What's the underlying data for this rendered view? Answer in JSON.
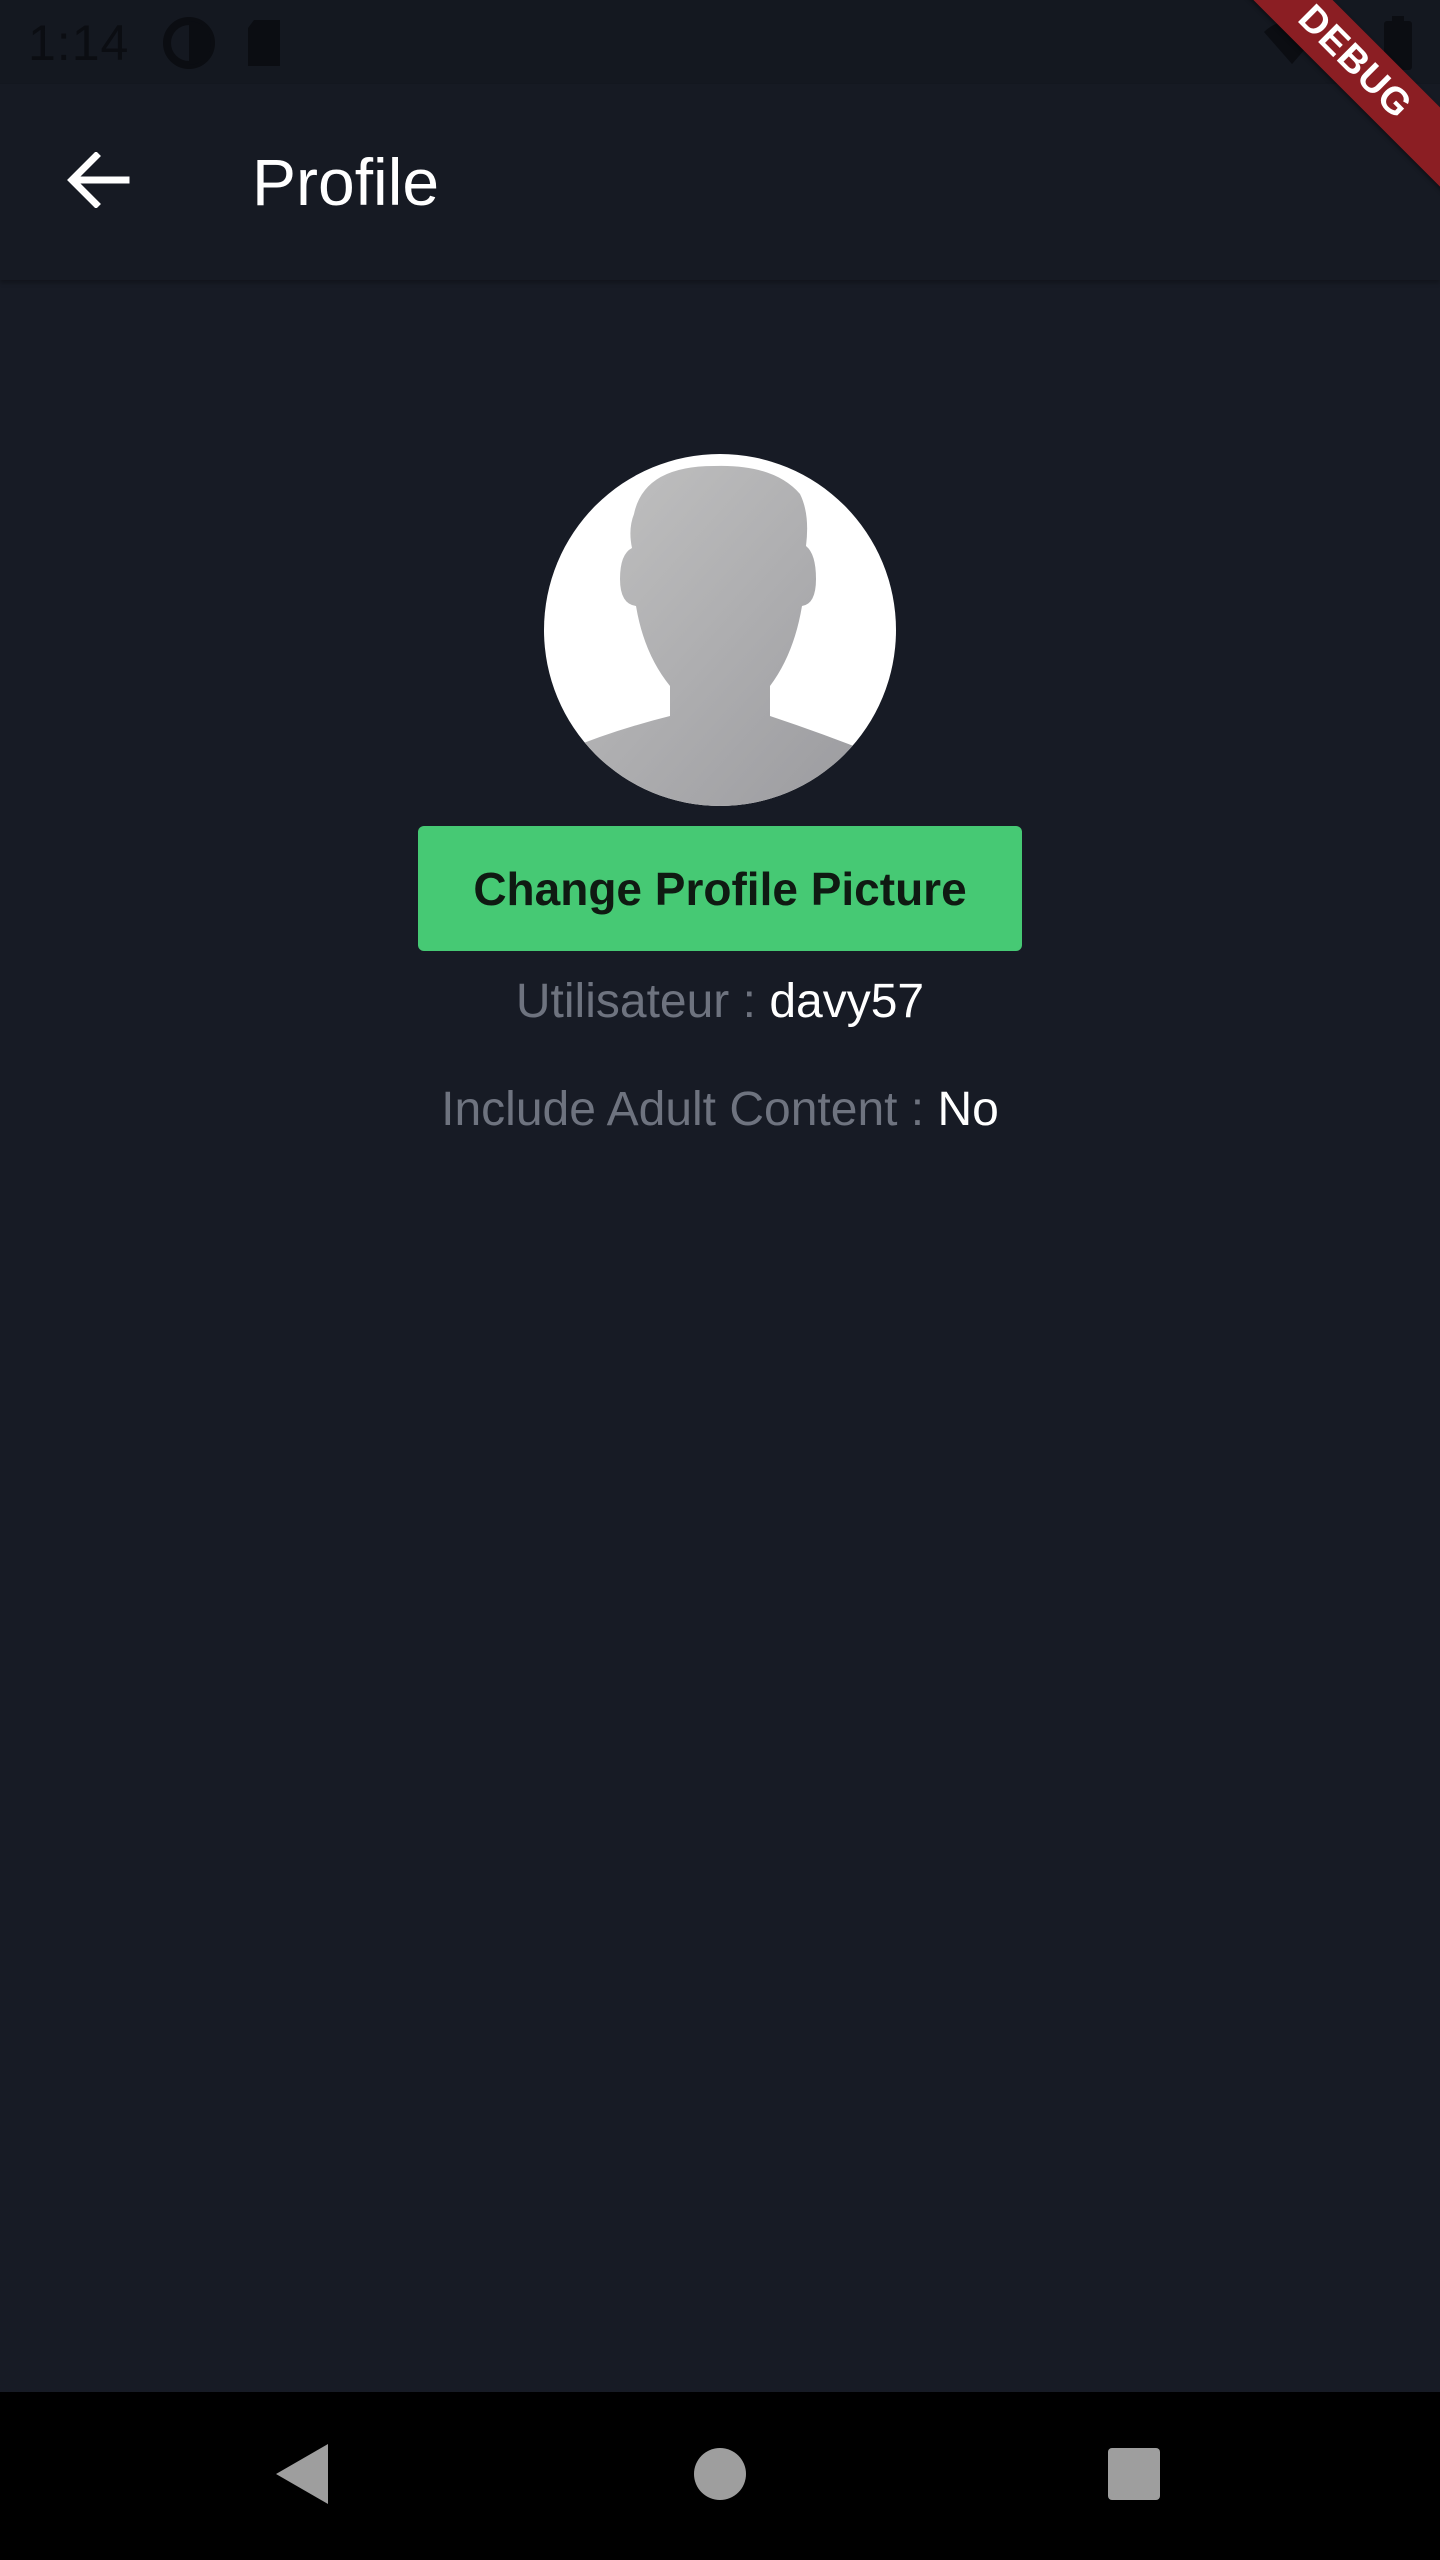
{
  "status_bar": {
    "time": "1:14",
    "icons": [
      "data-saver-icon",
      "sd-card-icon",
      "wifi-icon",
      "battery-icon"
    ]
  },
  "debug_banner": {
    "label": "DEBUG",
    "color": "#8b1e23"
  },
  "app_bar": {
    "back_icon": "arrow-back-icon",
    "title": "Profile"
  },
  "profile": {
    "avatar_icon": "default-avatar-silhouette-icon",
    "change_picture_label": "Change Profile Picture",
    "username_label": "Utilisateur :",
    "username_value": "davy57",
    "adult_content_label": "Include Adult Content :",
    "adult_content_value": "No"
  },
  "nav_bar": {
    "back_icon": "nav-back-icon",
    "home_icon": "nav-home-icon",
    "recents_icon": "nav-recents-icon"
  },
  "colors": {
    "background": "#171b25",
    "accent_green": "#46c974",
    "label_gray": "#6e737f",
    "text_white": "#ffffff"
  }
}
